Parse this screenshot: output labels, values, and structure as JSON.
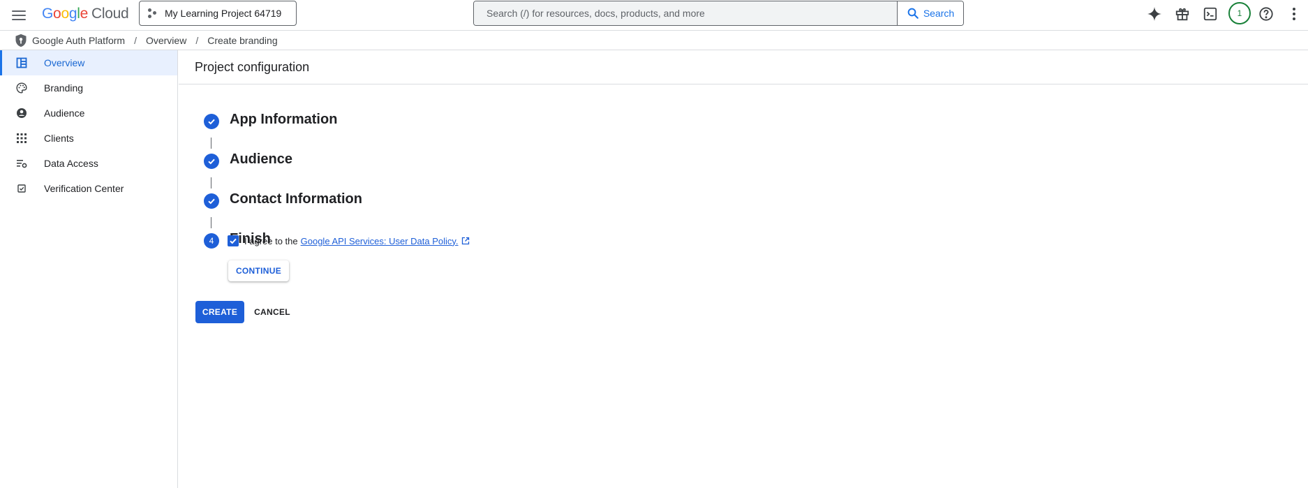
{
  "topbar": {
    "logo_google": "Google",
    "logo_cloud": "Cloud",
    "project_name": "My Learning Project 64719",
    "search_placeholder": "Search (/) for resources, docs, products, and more",
    "search_button": "Search",
    "avatar_initial": "1",
    "icons": [
      "menu-icon",
      "sparkle-icon",
      "gift-icon",
      "terminal-icon",
      "help-icon",
      "more-vert-icon"
    ]
  },
  "breadcrumb": {
    "items": [
      "Google Auth Platform",
      "Overview",
      "Create branding"
    ],
    "separator": "/"
  },
  "sidebar": {
    "items": [
      {
        "label": "Overview",
        "icon": "dashboard-icon",
        "active": true
      },
      {
        "label": "Branding",
        "icon": "palette-icon",
        "active": false
      },
      {
        "label": "Audience",
        "icon": "person-circle-icon",
        "active": false
      },
      {
        "label": "Clients",
        "icon": "apps-grid-icon",
        "active": false
      },
      {
        "label": "Data Access",
        "icon": "list-settings-icon",
        "active": false
      },
      {
        "label": "Verification Center",
        "icon": "checked-calendar-icon",
        "active": false
      }
    ]
  },
  "main": {
    "page_title": "Project configuration",
    "steps": [
      {
        "title": "App Information",
        "state": "complete"
      },
      {
        "title": "Audience",
        "state": "complete"
      },
      {
        "title": "Contact Information",
        "state": "complete"
      },
      {
        "title": "Finish",
        "state": "current",
        "number": "4"
      }
    ],
    "agree_text": "I agree to the",
    "agree_checked": true,
    "policy_link": "Google API Services: User Data Policy.",
    "continue_button": "CONTINUE",
    "create_button": "CREATE",
    "cancel_button": "CANCEL"
  },
  "colors": {
    "accent": "#1e5fd8",
    "active_nav_bg": "#e8f0fe",
    "avatar_ring": "#188038"
  }
}
